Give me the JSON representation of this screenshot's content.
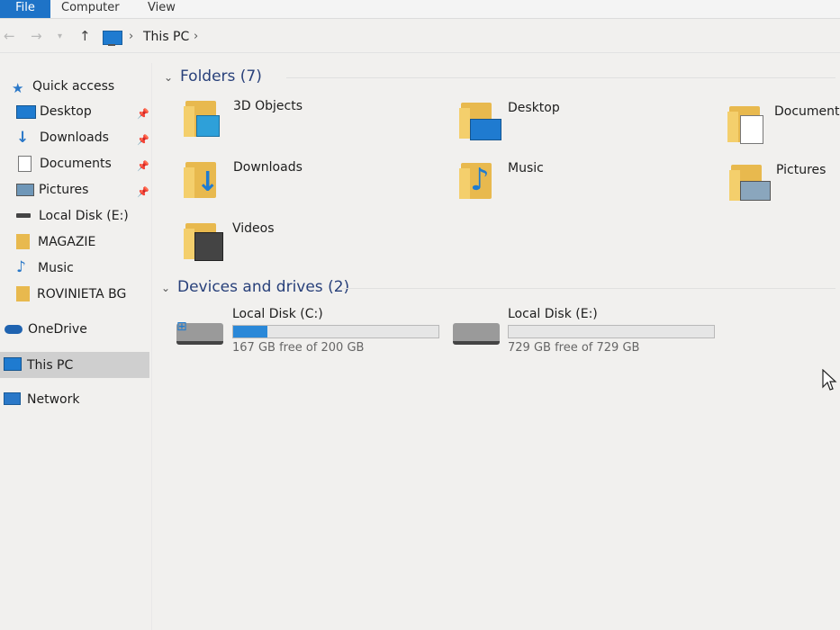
{
  "ribbon": {
    "tabs": [
      "File",
      "Computer",
      "View"
    ]
  },
  "address": {
    "location": "This PC",
    "separator": "›"
  },
  "sidebar": {
    "items": [
      {
        "label": "Quick access",
        "icon": "star-icon",
        "pinned": false
      },
      {
        "label": "Desktop",
        "icon": "desktop-icon",
        "pinned": true
      },
      {
        "label": "Downloads",
        "icon": "downloads-icon",
        "pinned": true
      },
      {
        "label": "Documents",
        "icon": "documents-icon",
        "pinned": true
      },
      {
        "label": "Pictures",
        "icon": "pictures-icon",
        "pinned": true
      },
      {
        "label": "Local Disk (E:)",
        "icon": "drive-icon",
        "pinned": false
      },
      {
        "label": "MAGAZIE",
        "icon": "folder-icon",
        "pinned": false
      },
      {
        "label": "Music",
        "icon": "music-icon",
        "pinned": false
      },
      {
        "label": "ROVINIETA BG",
        "icon": "folder-icon",
        "pinned": false
      },
      {
        "label": "OneDrive",
        "icon": "cloud-icon",
        "pinned": false
      },
      {
        "label": "This PC",
        "icon": "pc-icon",
        "pinned": false,
        "selected": true
      },
      {
        "label": "Network",
        "icon": "network-icon",
        "pinned": false
      }
    ]
  },
  "folders": {
    "heading": "Folders (7)",
    "items": [
      {
        "label": "3D Objects",
        "icon": "3d-objects-icon"
      },
      {
        "label": "Desktop",
        "icon": "desktop-icon"
      },
      {
        "label": "Documents",
        "icon": "documents-icon"
      },
      {
        "label": "Downloads",
        "icon": "downloads-icon"
      },
      {
        "label": "Music",
        "icon": "music-icon"
      },
      {
        "label": "Pictures",
        "icon": "pictures-icon"
      },
      {
        "label": "Videos",
        "icon": "videos-icon"
      }
    ]
  },
  "drives": {
    "heading": "Devices and drives (2)",
    "items": [
      {
        "label": "Local Disk (C:)",
        "size": "167 GB free of 200 GB",
        "used_fraction": 0.165
      },
      {
        "label": "Local Disk (E:)",
        "size": "729 GB free of 729 GB",
        "used_fraction": 0.0
      }
    ]
  },
  "colors": {
    "accent": "#1e73c7",
    "folder": "#e8b94e",
    "section_heading": "#28407a",
    "progress": "#2a88d8"
  }
}
